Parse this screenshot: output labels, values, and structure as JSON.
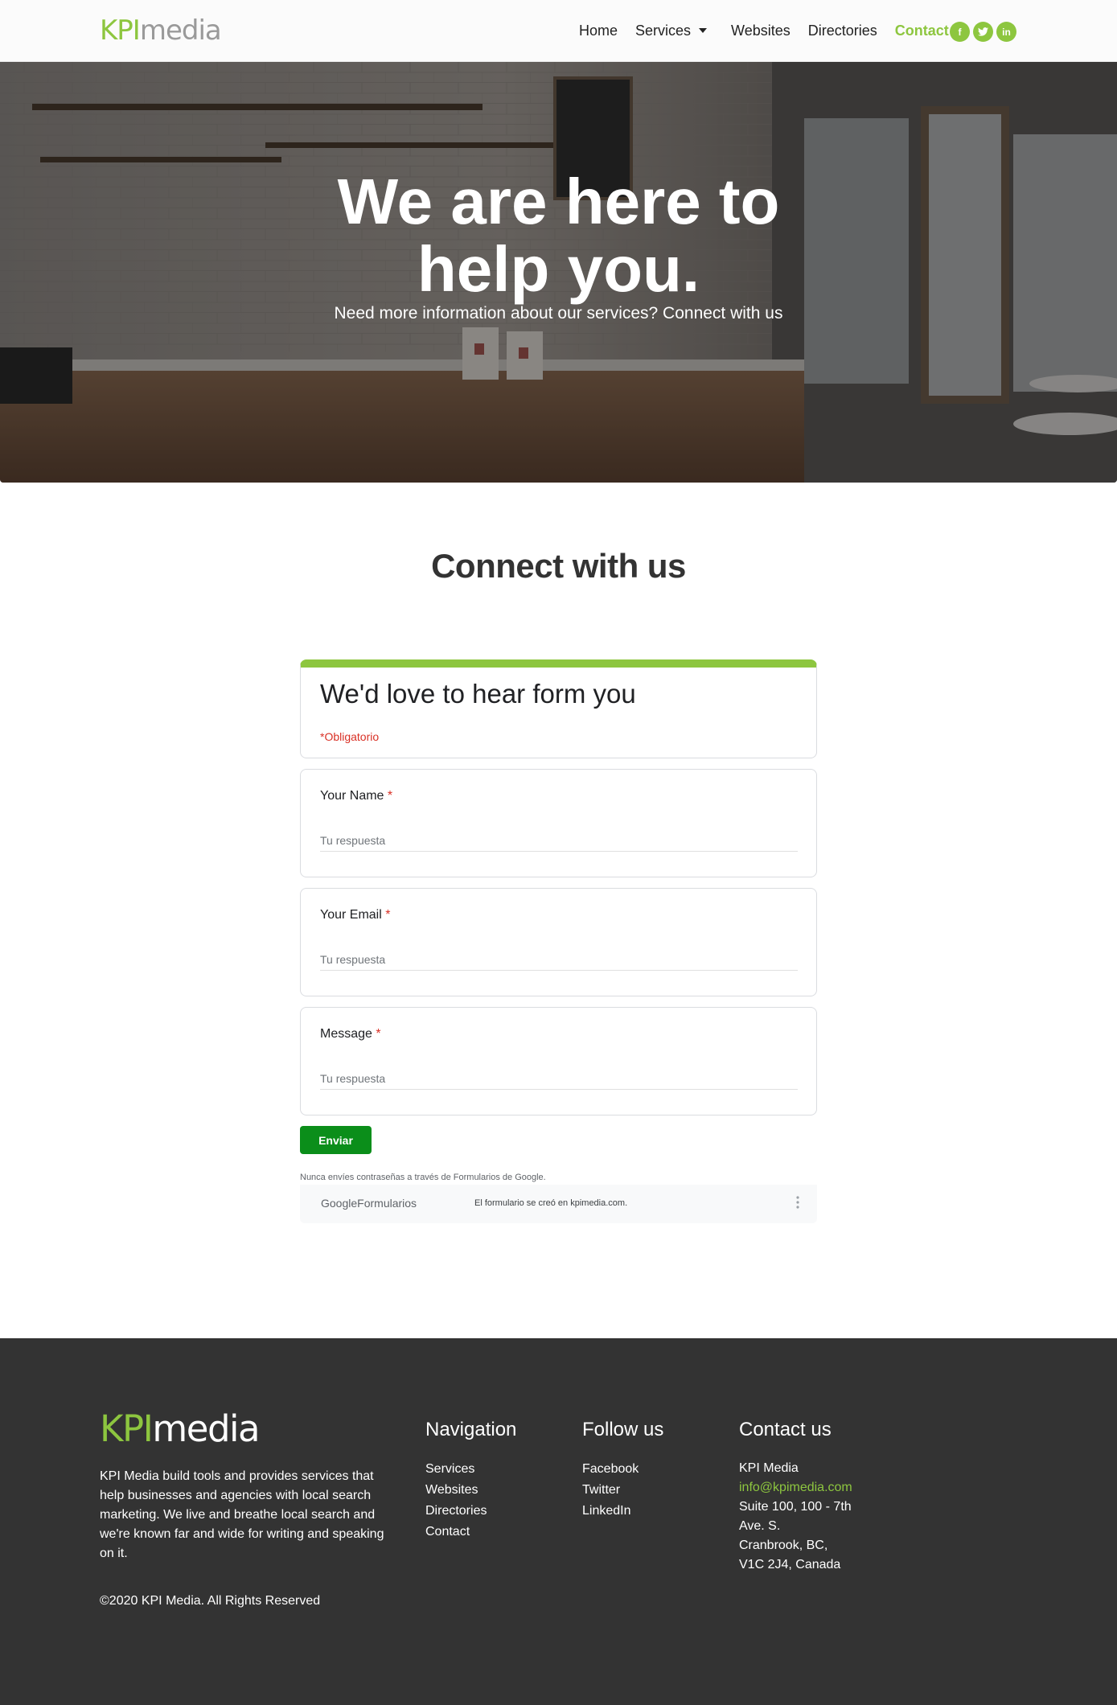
{
  "header": {
    "logo_kpi": "KPI",
    "logo_media": "media",
    "nav": {
      "home": "Home",
      "services": "Services",
      "websites": "Websites",
      "directories": "Directories",
      "contact": "Contact"
    },
    "socials": {
      "facebook": "f",
      "twitter": "t",
      "linkedin": "in"
    }
  },
  "hero": {
    "title_line1": "We are here to",
    "title_line2": "help you.",
    "subtitle": "Need more information about our services? Connect with us"
  },
  "section": {
    "title": "Connect with us"
  },
  "form": {
    "title": "We'd love to hear form you",
    "required_note": "*Obligatorio",
    "questions": [
      {
        "label": "Your Name",
        "star": "*",
        "placeholder": "Tu respuesta"
      },
      {
        "label": "Your Email",
        "star": "*",
        "placeholder": "Tu respuesta"
      },
      {
        "label": "Message",
        "star": "*",
        "placeholder": "Tu respuesta"
      }
    ],
    "submit_label": "Enviar",
    "warning": "Nunca envíes contraseñas a través de Formularios de Google.",
    "brand_google": "Google",
    "brand_forms": "Formularios",
    "created_note": "El formulario se creó en kpimedia.com."
  },
  "footer": {
    "logo_kpi": "KPI",
    "logo_media": "media",
    "about": "KPI Media build tools and provides services that help businesses and agencies with local search marketing. We live and breathe local search and we're known far and wide for writing and speaking on it.",
    "copyright": "©2020 KPI Media. All Rights Reserved",
    "navigation": {
      "title": "Navigation",
      "links": [
        "Services",
        "Websites",
        "Directories",
        "Contact"
      ]
    },
    "follow": {
      "title": "Follow us",
      "links": [
        "Facebook",
        "Twitter",
        "LinkedIn"
      ]
    },
    "contact": {
      "title": "Contact us",
      "company": "KPI Media",
      "email": "info@kpimedia.com",
      "address": [
        "Suite 100, 100 - 7th",
        "Ave. S.",
        "Cranbrook, BC,",
        "V1C 2J4, Canada"
      ]
    }
  },
  "colors": {
    "brand_green": "#8dc63f",
    "submit_green": "#0b8e1a",
    "footer_bg": "#333333",
    "required_red": "#d93025"
  }
}
